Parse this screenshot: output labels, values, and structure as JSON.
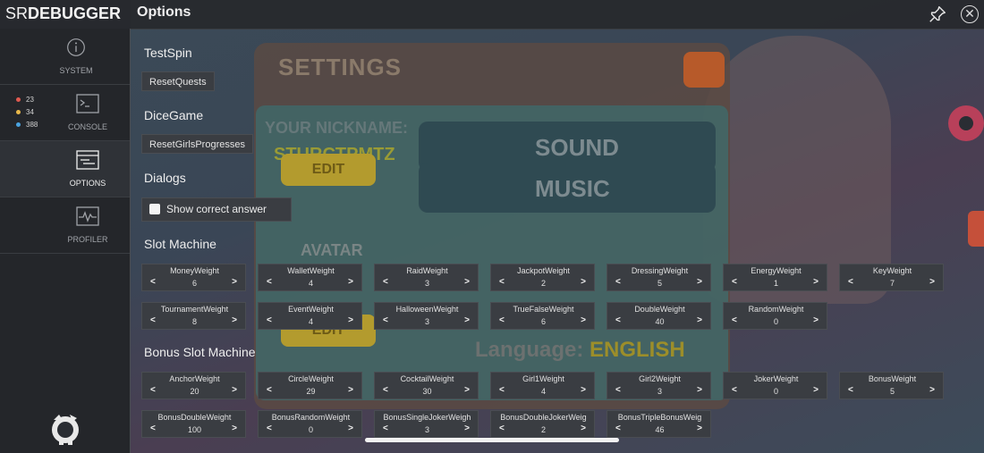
{
  "header": {
    "logo_prefix": "SR",
    "logo_suffix": "DEBUGGER",
    "title": "Options"
  },
  "sidebar": {
    "items": [
      {
        "label": "SYSTEM"
      },
      {
        "label": "CONSOLE"
      },
      {
        "label": "OPTIONS"
      },
      {
        "label": "PROFILER"
      }
    ],
    "console_counts": {
      "errors": "23",
      "warnings": "34",
      "info": "388"
    },
    "colors": {
      "error": "#e05a50",
      "warning": "#e9b84a",
      "info": "#4aa3e0"
    }
  },
  "background": {
    "settings_title": "SETTINGS",
    "nickname_label": "YOUR NICKNAME:",
    "nickname_value": "STURCTPMTZ",
    "edit_1": "EDIT",
    "edit_2": "EDIT",
    "avatar_label": "AVATAR",
    "sound": "SOUND",
    "music": "MUSIC",
    "language_label": "Language:",
    "language_value": "ENGLISH"
  },
  "options": {
    "test_spin": {
      "title": "TestSpin",
      "button": "ResetQuests"
    },
    "dice_game": {
      "title": "DiceGame",
      "button": "ResetGirlsProgresses"
    },
    "dialogs": {
      "title": "Dialogs",
      "checkbox": "Show correct answer",
      "checked": false
    },
    "slot_machine": {
      "title": "Slot Machine",
      "rows": [
        [
          {
            "name": "MoneyWeight",
            "value": "6"
          },
          {
            "name": "WalletWeight",
            "value": "4"
          },
          {
            "name": "RaidWeight",
            "value": "3"
          },
          {
            "name": "JackpotWeight",
            "value": "2"
          },
          {
            "name": "DressingWeight",
            "value": "5"
          },
          {
            "name": "EnergyWeight",
            "value": "1"
          },
          {
            "name": "KeyWeight",
            "value": "7"
          }
        ],
        [
          {
            "name": "TournamentWeight",
            "value": "8"
          },
          {
            "name": "EventWeight",
            "value": "4"
          },
          {
            "name": "HalloweenWeight",
            "value": "3"
          },
          {
            "name": "TrueFalseWeight",
            "value": "6"
          },
          {
            "name": "DoubleWeight",
            "value": "40"
          },
          {
            "name": "RandomWeight",
            "value": "0"
          }
        ]
      ]
    },
    "bonus_slot_machine": {
      "title": "Bonus Slot Machine",
      "rows": [
        [
          {
            "name": "AnchorWeight",
            "value": "20"
          },
          {
            "name": "CircleWeight",
            "value": "29"
          },
          {
            "name": "CocktailWeight",
            "value": "30"
          },
          {
            "name": "Girl1Weight",
            "value": "4"
          },
          {
            "name": "Girl2Weight",
            "value": "3"
          },
          {
            "name": "JokerWeight",
            "value": "0"
          },
          {
            "name": "BonusWeight",
            "value": "5"
          }
        ],
        [
          {
            "name": "BonusDoubleWeight",
            "value": "100"
          },
          {
            "name": "BonusRandomWeight",
            "value": "0"
          },
          {
            "name": "BonusSingleJokerWeigh",
            "value": "3"
          },
          {
            "name": "BonusDoubleJokerWeig",
            "value": "2"
          },
          {
            "name": "BonusTripleBonusWeig",
            "value": "46"
          }
        ]
      ]
    }
  }
}
